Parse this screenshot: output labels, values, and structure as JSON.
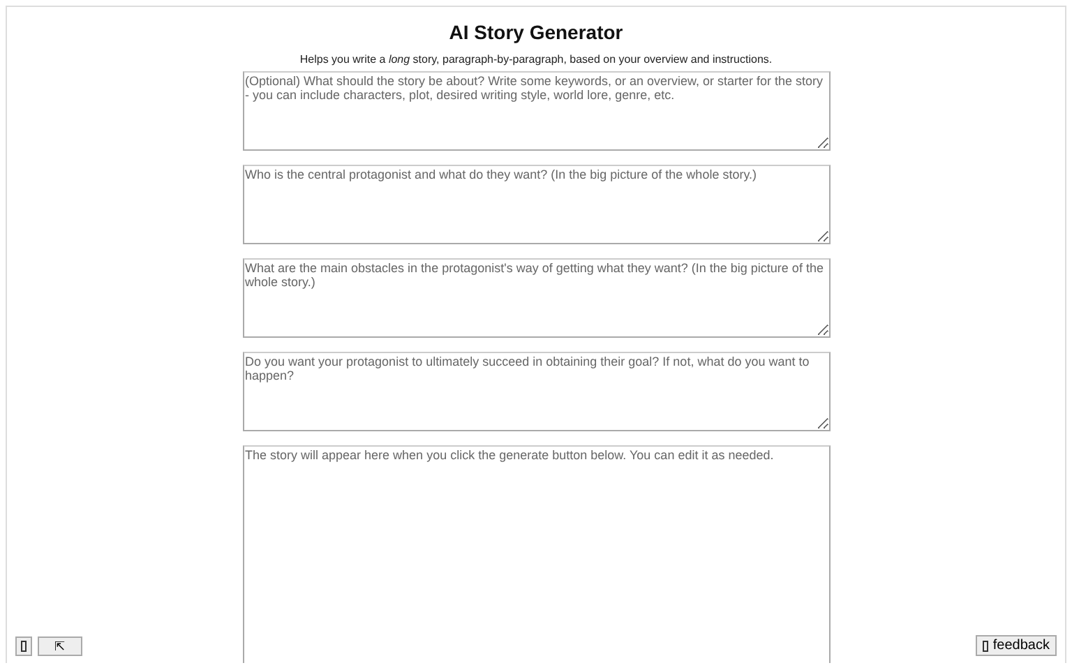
{
  "title": "AI Story Generator",
  "subtitle": "Helps you write a *long* story, paragraph-by-paragraph, based on your overview and instructions.",
  "fields": [
    {
      "placeholder": "(Optional) What should the story be about? Write some keywords, or an overview, or starter for the story - you can include characters, plot, desired writing style, world lore, genre, etc."
    },
    {
      "placeholder": "Who is the central protagonist and what do they want? (In the big picture of the whole story.)"
    },
    {
      "placeholder": "What are the main obstacles in the protagonist's way of getting what they want? (In the big picture of the whole story.)"
    },
    {
      "placeholder": "Do you want your protagonist to ultimately succeed in obtaining their goal? If not, what do you want to happen?"
    }
  ],
  "output": {
    "placeholder": "The story will appear here when you click the generate button below. You can edit it as needed."
  },
  "corner_buttons": {
    "expand": "⇱",
    "feedback": "feedback"
  }
}
